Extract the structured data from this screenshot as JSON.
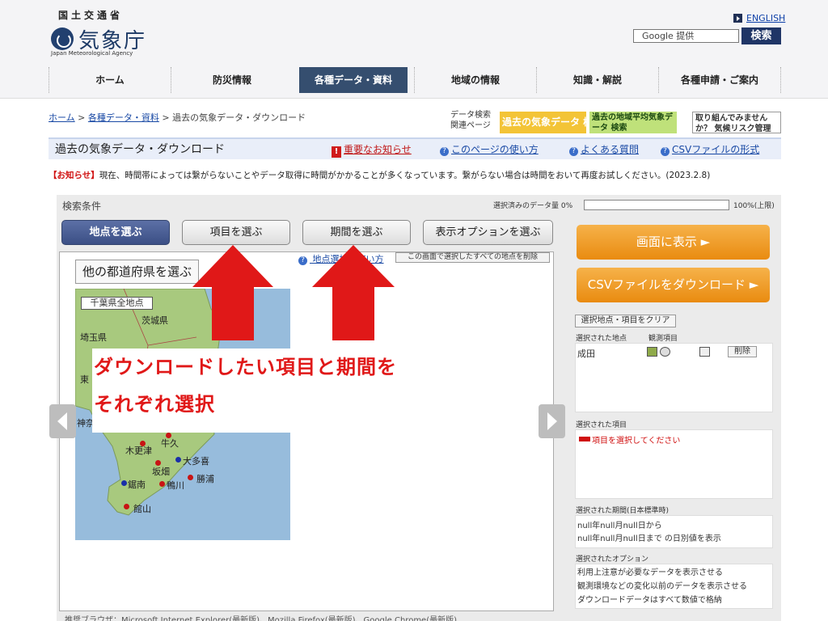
{
  "header": {
    "ministry": "国土交通省",
    "agency": "気象庁",
    "agency_en": "Japan Meteorological Agency",
    "english_link": "ENGLISH",
    "search_placeholder": "Google 提供",
    "search_button": "検索"
  },
  "nav": {
    "items": [
      "ホーム",
      "防災情報",
      "各種データ・資料",
      "地域の情報",
      "知識・解説",
      "各種申請・ご案内"
    ],
    "active_index": 2
  },
  "breadcrumb": [
    "ホーム",
    "各種データ・資料",
    "過去の気象データ・ダウンロード"
  ],
  "related": {
    "label": "データ検索\n関連ページ",
    "banner1": "過去の気象データ 検索",
    "banner2": "過去の地域平均気象データ 検索",
    "banner3": "取り組んでみませんか？ 気候リスク管理"
  },
  "page": {
    "title": "過去の気象データ・ダウンロード",
    "links": [
      "重要なお知らせ",
      "このページの使い方",
      "よくある質問",
      "CSVファイルの形式"
    ]
  },
  "notice": {
    "tag": "【お知らせ】",
    "text": "現在、時間帯によっては繋がらないことやデータ取得に時間がかかることが多くなっています。繋がらない場合は時間をおいて再度お試しください。(2023.2.8)"
  },
  "search": {
    "title": "検索条件",
    "progress_label": "選択済みのデータ量 0%",
    "progress_value": 0,
    "progress_max": "100%(上限)",
    "tabs": [
      "地点を選ぶ",
      "項目を選ぶ",
      "期間を選ぶ",
      "表示オプションを選ぶ"
    ],
    "active_tab": 0,
    "other_pref": "他の都道府県を選ぶ",
    "help_link": "地点選択の使い方",
    "remove_all": "この画面で選択したすべての地点を削除",
    "chiba_all": "千葉県全地点"
  },
  "map": {
    "labels": [
      "茨城県",
      "埼玉県",
      "東",
      "神奈",
      "牛久",
      "木更津",
      "大多喜",
      "坂畑",
      "鴨川",
      "勝浦",
      "鋸南",
      "館山",
      "千"
    ]
  },
  "overlay": {
    "line1": "ダウンロードしたい項目と期間を",
    "line2": "それぞれ選択"
  },
  "sidebar": {
    "show_btn": "画面に表示 ►",
    "csv_btn": "CSVファイルをダウンロード ►",
    "clear_btn": "選択地点・項目をクリア",
    "sel_station_label": "選択された地点",
    "obs_label": "観測項目",
    "station": "成田",
    "delete": "削除",
    "sel_item_label": "選択された項目",
    "item_prompt": "項目を選択してください",
    "period_label": "選択された期間(日本標準時)",
    "period_from": "null年null月null日から",
    "period_to": "null年null月null日まで の日別値を表示",
    "option_label": "選択されたオプション",
    "options": [
      "利用上注意が必要なデータを表示させる",
      "観測環境などの変化以前のデータを表示させる",
      "ダウンロードデータはすべて数値で格納"
    ]
  },
  "footer": {
    "browsers": "推奨ブラウザ：Microsoft Internet Explorer(最新版)、Mozilla Firefox(最新版)、Google Chrome(最新版)"
  },
  "colors": {
    "nav_active": "#354e6f",
    "arrow": "#e01818",
    "orange_btn": "#ee9a1f",
    "tab_active": "#3b4f85"
  }
}
